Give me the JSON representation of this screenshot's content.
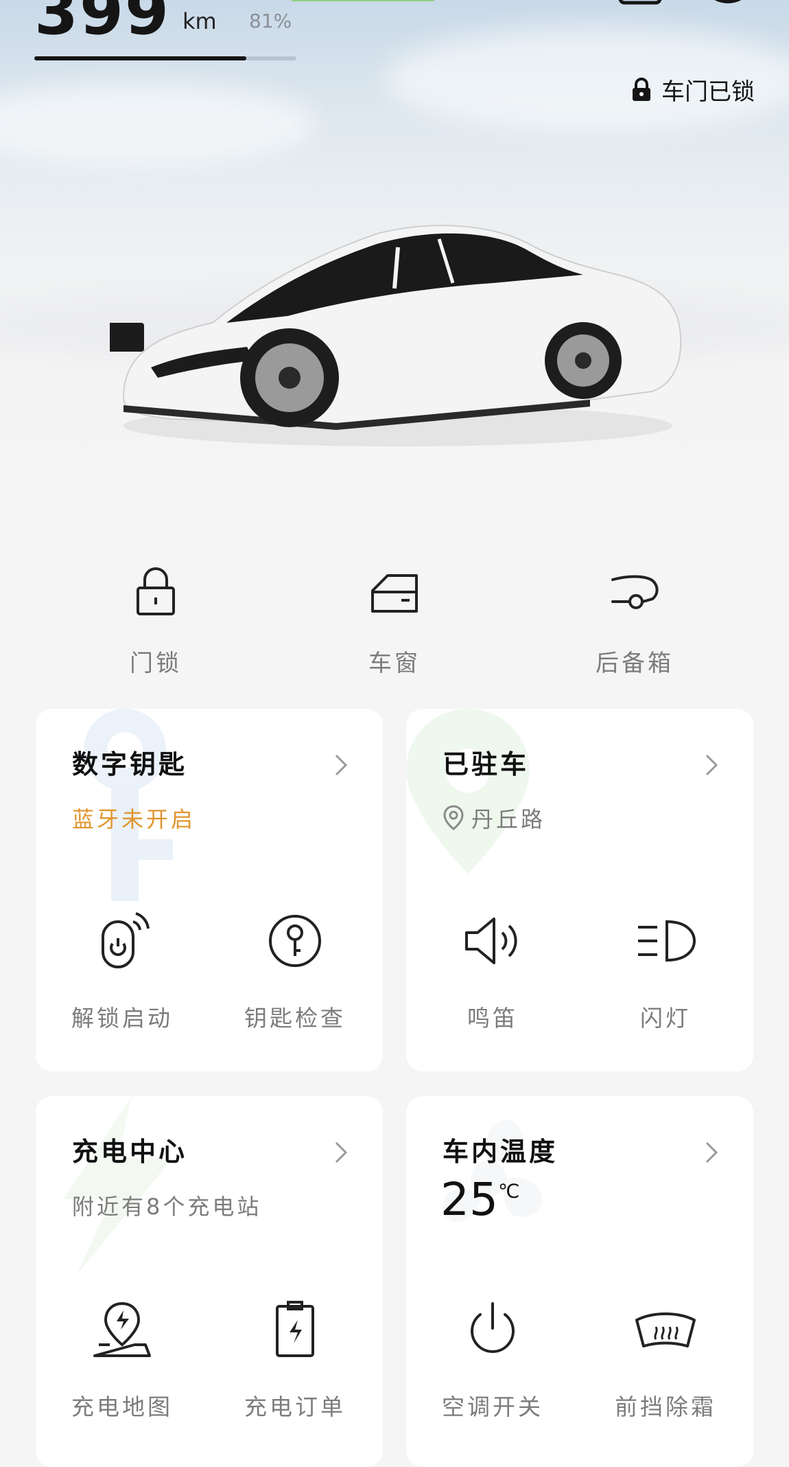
{
  "header": {
    "range_value": "399",
    "range_unit": "km",
    "battery_percent_text": "81%",
    "battery_level": 0.81,
    "lock_status": "车门已锁"
  },
  "quick_controls": [
    {
      "label": "门锁",
      "icon": "padlock-icon"
    },
    {
      "label": "车窗",
      "icon": "window-icon"
    },
    {
      "label": "后备箱",
      "icon": "trunk-icon"
    }
  ],
  "cards": {
    "digital_key": {
      "title": "数字钥匙",
      "subtitle": "蓝牙未开启",
      "subtitle_color": "#e0952e",
      "actions": [
        {
          "label": "解锁启动",
          "icon": "unlock-start-icon"
        },
        {
          "label": "钥匙检查",
          "icon": "key-check-icon"
        }
      ]
    },
    "parked": {
      "title": "已驻车",
      "location": "丹丘路",
      "actions": [
        {
          "label": "鸣笛",
          "icon": "horn-icon"
        },
        {
          "label": "闪灯",
          "icon": "flash-lights-icon"
        }
      ]
    },
    "charging": {
      "title": "充电中心",
      "subtitle": "附近有8个充电站",
      "actions": [
        {
          "label": "充电地图",
          "icon": "charging-map-icon"
        },
        {
          "label": "充电订单",
          "icon": "charging-order-icon"
        }
      ]
    },
    "climate": {
      "title": "车内温度",
      "temperature": "25",
      "temperature_unit": "℃",
      "actions": [
        {
          "label": "空调开关",
          "icon": "ac-power-icon"
        },
        {
          "label": "前挡除霜",
          "icon": "defrost-icon"
        }
      ]
    }
  },
  "colors": {
    "accent_orange": "#e0952e",
    "text_primary": "#111111",
    "text_secondary": "#7c7c7c",
    "page_bg": "#f5f5f5",
    "card_bg": "#ffffff"
  }
}
